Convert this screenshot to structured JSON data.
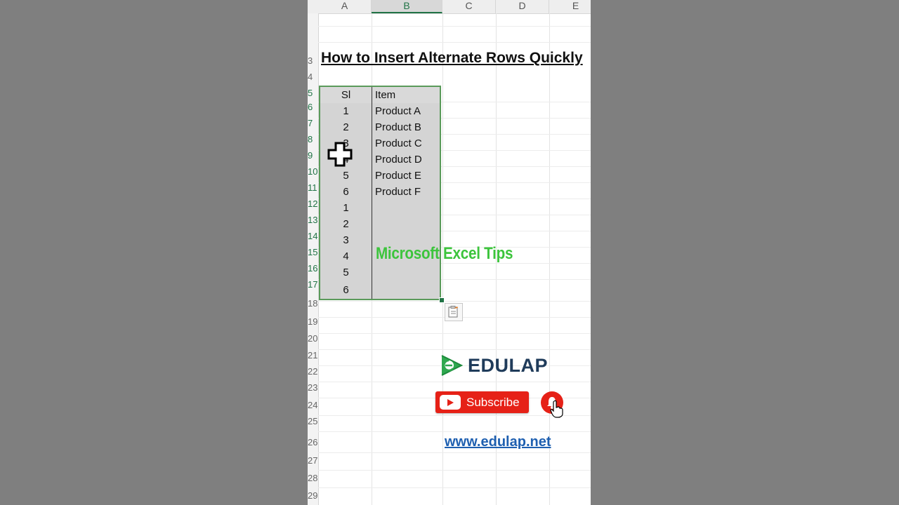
{
  "spreadsheet": {
    "column_headers": [
      "A",
      "B",
      "C",
      "D",
      "E"
    ],
    "row_numbers": [
      "3",
      "4",
      "5",
      "6",
      "7",
      "8",
      "9",
      "10",
      "11",
      "12",
      "13",
      "14",
      "15",
      "16",
      "17",
      "18",
      "19",
      "20",
      "21",
      "22",
      "23",
      "24",
      "25",
      "26",
      "27",
      "28",
      "29"
    ],
    "title": "How to Insert Alternate Rows Quickly",
    "table": {
      "headers": [
        "Sl",
        "Item"
      ],
      "rows": [
        [
          "1",
          "Product A"
        ],
        [
          "2",
          "Product B"
        ],
        [
          "3",
          "Product C"
        ],
        [
          "4",
          "Product D"
        ],
        [
          "5",
          "Product E"
        ],
        [
          "6",
          "Product F"
        ],
        [
          "1",
          ""
        ],
        [
          "2",
          ""
        ],
        [
          "3",
          ""
        ],
        [
          "4",
          ""
        ],
        [
          "5",
          ""
        ],
        [
          "6",
          ""
        ]
      ]
    },
    "selection_color": "#217346"
  },
  "overlay": {
    "watermark": "Microsoft  Excel Tips",
    "brand_name": "EDULAP",
    "subscribe_label": "Subscribe",
    "website": "www.edulap.net",
    "icons": [
      "cursor-plus-icon",
      "paste-options-icon",
      "edulap-logo-icon",
      "youtube-play-icon",
      "bell-icon",
      "hand-pointer-icon"
    ]
  },
  "colors": {
    "background_sides": "#7f7f7f",
    "watermark": "#3cc43c",
    "brand_text": "#1f3b5a",
    "subscribe_red": "#e62117",
    "link_blue": "#1e5fb0"
  }
}
